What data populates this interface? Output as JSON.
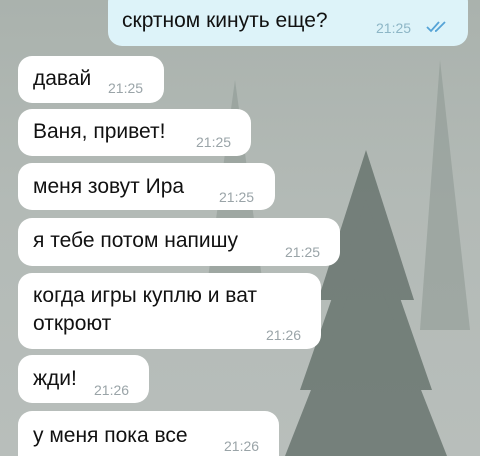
{
  "outgoing": {
    "text": "скртном кинуть еще?",
    "time": "21:25",
    "status_icon": "double-check-icon"
  },
  "incoming": [
    {
      "lines": [
        "давай"
      ],
      "time": "21:25"
    },
    {
      "lines": [
        "Ваня, привет!"
      ],
      "time": "21:25"
    },
    {
      "lines": [
        "меня зовут Ира"
      ],
      "time": "21:25"
    },
    {
      "lines": [
        "я тебе потом напишу"
      ],
      "time": "21:25"
    },
    {
      "lines": [
        "когда игры куплю и ват",
        "откроют"
      ],
      "time": "21:26"
    },
    {
      "lines": [
        "жди!"
      ],
      "time": "21:26"
    },
    {
      "lines": [
        "у меня пока все"
      ],
      "time": "21:26"
    }
  ],
  "colors": {
    "incoming_bubble": "#ffffff",
    "outgoing_bubble": "#ddf3f9",
    "read_check": "#55a3d6"
  }
}
